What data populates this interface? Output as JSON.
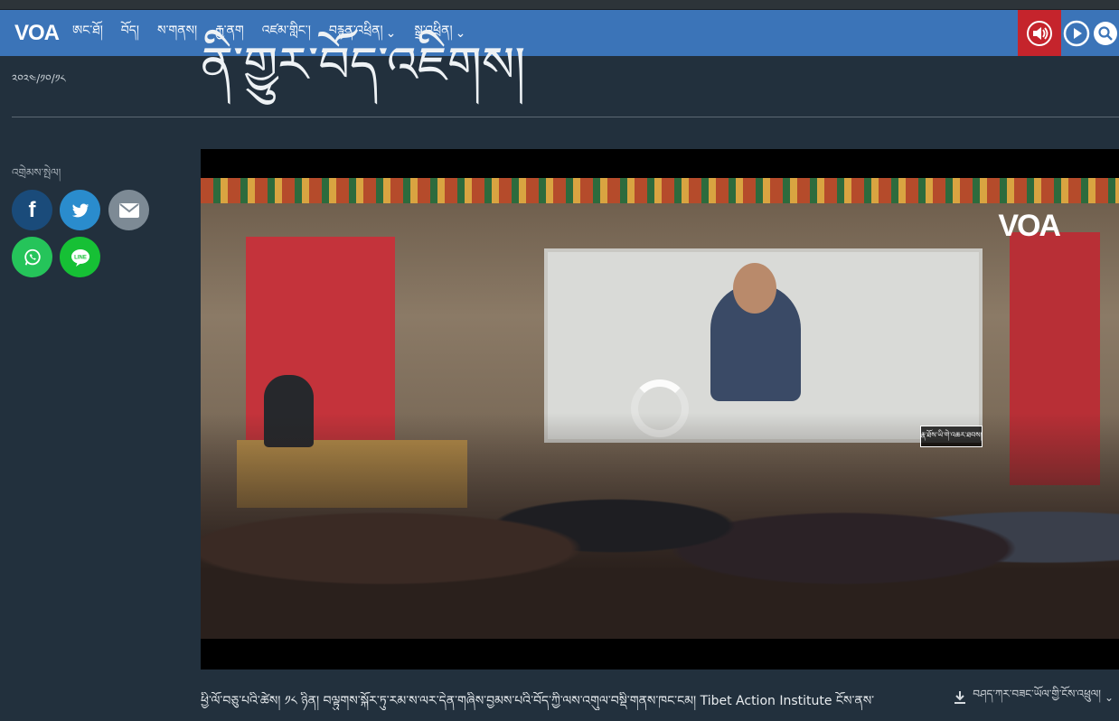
{
  "header": {
    "logo": "VOA",
    "nav": [
      {
        "label": "ཨང་ཐོ།",
        "dropdown": false
      },
      {
        "label": "བོད།",
        "dropdown": false
      },
      {
        "label": "ས་གནས།",
        "dropdown": false
      },
      {
        "label": "རྒྱ་ནག",
        "dropdown": false
      },
      {
        "label": "འཛམ་གླིང་།",
        "dropdown": false
      },
      {
        "label": "བརྙན་འཕྲིན།",
        "dropdown": true
      },
      {
        "label": "སྒྲ་འཕྲིན།",
        "dropdown": true
      }
    ],
    "icons": {
      "audio": "speaker-icon",
      "play": "play-circle-icon",
      "search": "search-icon"
    },
    "accent_color": "#3b74b8",
    "audio_bg": "#c5242c"
  },
  "article": {
    "date": "༢༠༢༤/༡༠/༡༨",
    "title": "ནི་གྱུར་བོད་འཇིགས།",
    "share_label": "འགྲེམས་སྤེལ།",
    "share": [
      {
        "name": "facebook",
        "icon": "f",
        "color": "#1a4b7a"
      },
      {
        "name": "twitter",
        "icon": "twitter-bird-icon",
        "color": "#2a8ccd"
      },
      {
        "name": "email",
        "icon": "envelope-icon",
        "color": "#7d8a95"
      },
      {
        "name": "whatsapp",
        "icon": "whatsapp-icon",
        "color": "#25c45a"
      },
      {
        "name": "line",
        "icon": "LINE",
        "color": "#16c035"
      }
    ],
    "video": {
      "logo": "VOA",
      "caption_button": "རྣ་ཐོས་ཡི་གེ་འཆར་ཐབས།"
    },
    "download_label": "བཤད་ཀར་བཟང་ཡོལ་གྱི་ངོས་འཕྲུལ།",
    "body_text": "ཕྱི་ལོ་བཅུ་པའི་ཚེས། ༡༨ ཉིན། བལྟུགས་སྐོར་ཏུ་རམ་ས་ལར་དེན་གཞིས་བྱམས་པའི་བོད་ཀྱི་ལས་འགུལ་བསྡི་གནས་ཁང་ངམ། Tibet Action Institute ངོས་ནས་"
  }
}
